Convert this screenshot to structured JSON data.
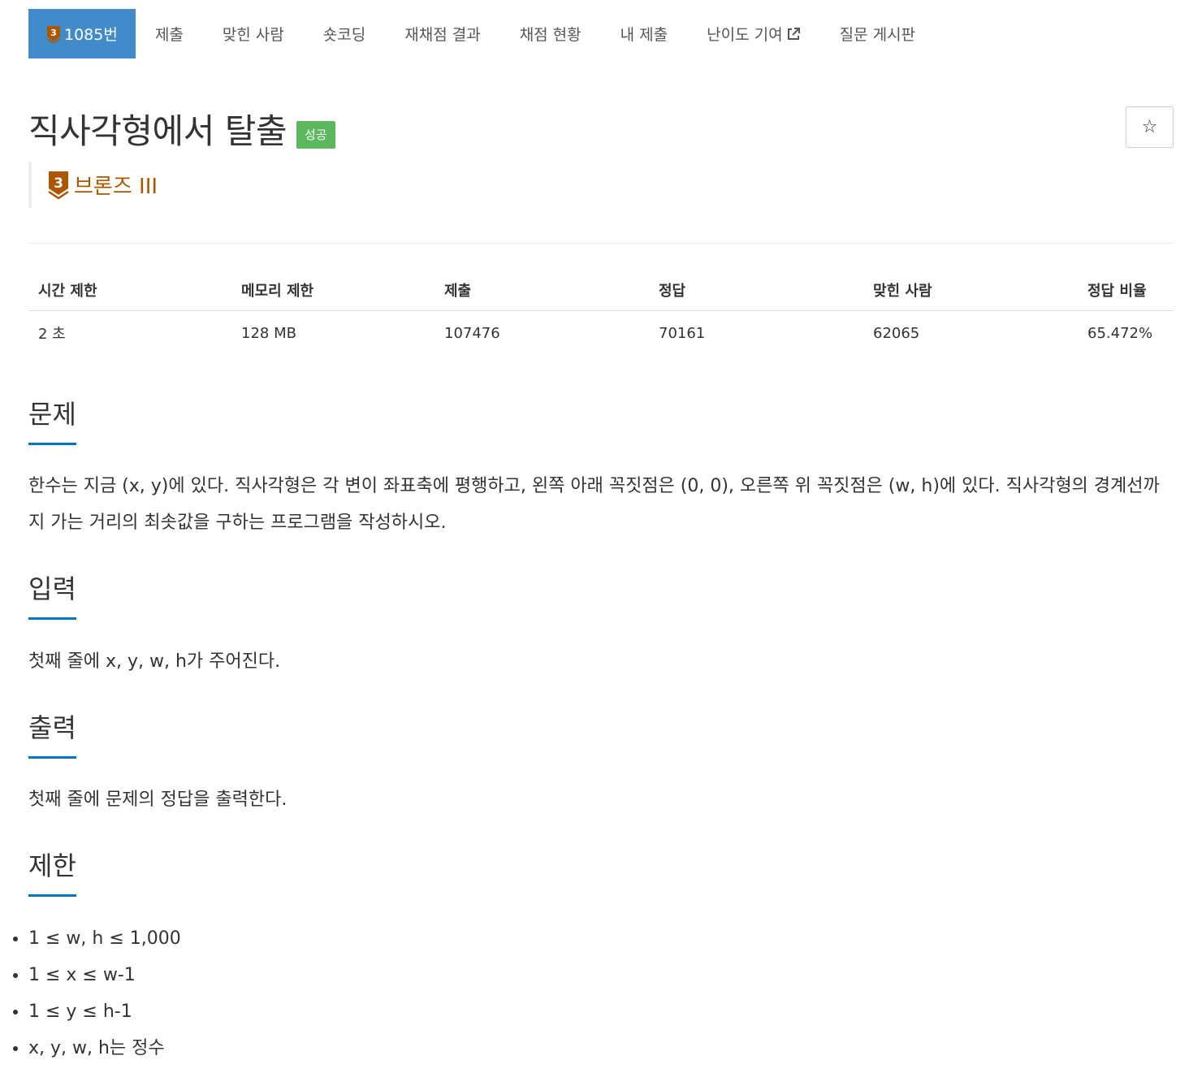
{
  "nav": {
    "problem_tier_digit": "3",
    "problem_number": "1085번",
    "items": [
      "제출",
      "맞힌 사람",
      "숏코딩",
      "재채점 결과",
      "채점 현황",
      "내 제출",
      "난이도 기여",
      "질문 게시판"
    ]
  },
  "problem": {
    "title": "직사각형에서 탈출",
    "status_badge": "성공",
    "star_glyph": "☆",
    "tier_digit": "3",
    "tier_label": "브론즈 III",
    "tier_color": "#ad5600"
  },
  "info_table": {
    "headers": [
      "시간 제한",
      "메모리 제한",
      "제출",
      "정답",
      "맞힌 사람",
      "정답 비율"
    ],
    "values": [
      "2 초",
      "128 MB",
      "107476",
      "70161",
      "62065",
      "65.472%"
    ]
  },
  "sections": {
    "description": {
      "heading": "문제",
      "text": "한수는 지금 (x, y)에 있다. 직사각형은 각 변이 좌표축에 평행하고, 왼쪽 아래 꼭짓점은 (0, 0), 오른쪽 위 꼭짓점은 (w, h)에 있다. 직사각형의 경계선까지 가는 거리의 최솟값을 구하는 프로그램을 작성하시오."
    },
    "input": {
      "heading": "입력",
      "text": "첫째 줄에 x, y, w, h가 주어진다."
    },
    "output": {
      "heading": "출력",
      "text": "첫째 줄에 문제의 정답을 출력한다."
    },
    "limits": {
      "heading": "제한",
      "items": [
        "1 ≤ w, h ≤ 1,000",
        "1 ≤ x ≤ w-1",
        "1 ≤ y ≤ h-1",
        "x, y, w, h는 정수"
      ]
    }
  },
  "colors": {
    "nav_active": "#428bca",
    "badge_success": "#5cb85c",
    "section_underline": "#0076c0"
  }
}
